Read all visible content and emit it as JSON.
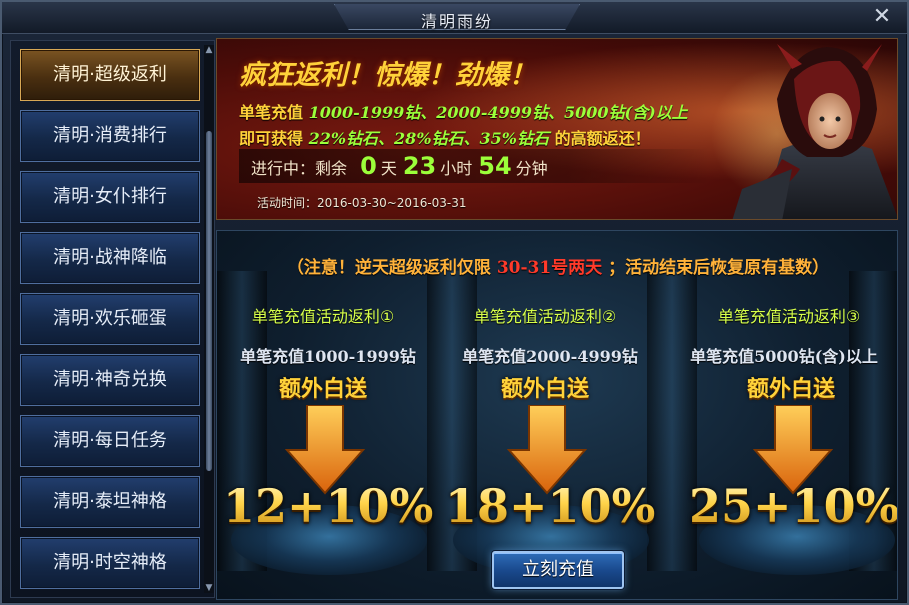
{
  "window": {
    "title": "清明雨纷",
    "close_icon": "close-icon"
  },
  "sidebar": {
    "items": [
      {
        "label": "清明·超级返利",
        "active": true
      },
      {
        "label": "清明·消费排行",
        "active": false
      },
      {
        "label": "清明·女仆排行",
        "active": false
      },
      {
        "label": "清明·战神降临",
        "active": false
      },
      {
        "label": "清明·欢乐砸蛋",
        "active": false
      },
      {
        "label": "清明·神奇兑换",
        "active": false
      },
      {
        "label": "清明·每日任务",
        "active": false
      },
      {
        "label": "清明·泰坦神格",
        "active": false
      },
      {
        "label": "清明·时空神格",
        "active": false
      }
    ]
  },
  "banner": {
    "headline": "疯狂返利！惊爆！劲爆！",
    "line1_prefix": "单笔充值 ",
    "line1_tiers": "1000-1999钻、2000-4999钻、5000钻(含)以上",
    "line2_prefix": "即可获得 ",
    "line2_rates": "22%钻石、28%钻石、35%钻石",
    "line2_suffix": " 的高额返还！",
    "progress": {
      "label": "进行中：剩余",
      "days": "0",
      "days_unit": "天",
      "hours": "23",
      "hours_unit": "小时",
      "minutes": "54",
      "minutes_unit": "分钟"
    },
    "activity_time": "活动时间：2016-03-30~2016-03-31"
  },
  "main": {
    "notice_prefix": "（注意！逆天超级返利仅限 ",
    "notice_highlight": "30-31号两天",
    "notice_suffix": " ；活动结束后恢复原有基数）",
    "tiers": [
      {
        "title": "单笔充值活动返利①",
        "desc": "单笔充值1000-1999钻",
        "extra": "额外白送",
        "value": "12+10%"
      },
      {
        "title": "单笔充值活动返利②",
        "desc": "单笔充值2000-4999钻",
        "extra": "额外白送",
        "value": "18+10%"
      },
      {
        "title": "单笔充值活动返利③",
        "desc": "单笔充值5000钻(含)以上",
        "extra": "额外白送",
        "value": "25+10%"
      }
    ],
    "recharge_button": "立刻充值"
  },
  "colors": {
    "gold": "#ffd23a",
    "green": "#9cff3a",
    "red_highlight": "#ff3a2a",
    "active_tab": "#d8a855",
    "button_blue": "#2e6cb8"
  }
}
